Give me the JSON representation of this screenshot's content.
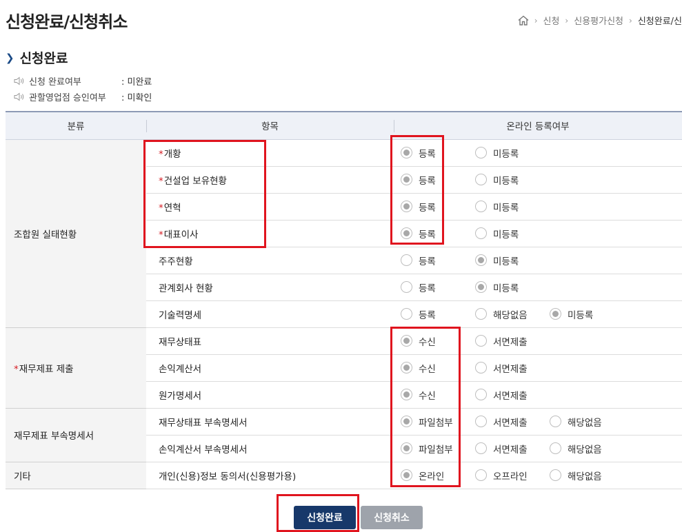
{
  "page_title": "신청완료/신청취소",
  "breadcrumb": {
    "items": [
      "신청",
      "신용평가신청"
    ],
    "current": "신청완료/신"
  },
  "section_title": "신청완료",
  "info": [
    {
      "label": "신청 완료여부",
      "value": ": 미완료"
    },
    {
      "label": "관할영업점 승인여부",
      "value": ": 미확인"
    }
  ],
  "table": {
    "headers": [
      "분류",
      "항목",
      "온라인 등록여부"
    ],
    "categories": {
      "c1": "조합원 실태현황",
      "c2": "재무제표 제출",
      "c3": "재무제표 부속명세서",
      "c4": "기타"
    },
    "rows": [
      {
        "item": "개황",
        "options": [
          "등록",
          "미등록"
        ]
      },
      {
        "item": "건설업 보유현황",
        "options": [
          "등록",
          "미등록"
        ]
      },
      {
        "item": "연혁",
        "options": [
          "등록",
          "미등록"
        ]
      },
      {
        "item": "대표이사",
        "options": [
          "등록",
          "미등록"
        ]
      },
      {
        "item": "주주현황",
        "options": [
          "등록",
          "미등록"
        ]
      },
      {
        "item": "관계회사 현황",
        "options": [
          "등록",
          "미등록"
        ]
      },
      {
        "item": "기술력명세",
        "options": [
          "등록",
          "해당없음",
          "미등록"
        ]
      },
      {
        "item": "재무상태표",
        "options": [
          "수신",
          "서면제출"
        ]
      },
      {
        "item": "손익계산서",
        "options": [
          "수신",
          "서면제출"
        ]
      },
      {
        "item": "원가명세서",
        "options": [
          "수신",
          "서면제출"
        ]
      },
      {
        "item": "재무상태표 부속명세서",
        "options": [
          "파일첨부",
          "서면제출",
          "해당없음"
        ]
      },
      {
        "item": "손익계산서 부속명세서",
        "options": [
          "파일첨부",
          "서면제출",
          "해당없음"
        ]
      },
      {
        "item": "개인(신용)정보 동의서(신용평가용)",
        "options": [
          "온라인",
          "오프라인",
          "해당없음"
        ]
      }
    ]
  },
  "buttons": {
    "complete": "신청완료",
    "cancel": "신청취소"
  },
  "colors": {
    "primary_button": "#17386a",
    "secondary_button": "#9ea3ab",
    "highlight": "#e0141e",
    "required": "#d51b22"
  }
}
